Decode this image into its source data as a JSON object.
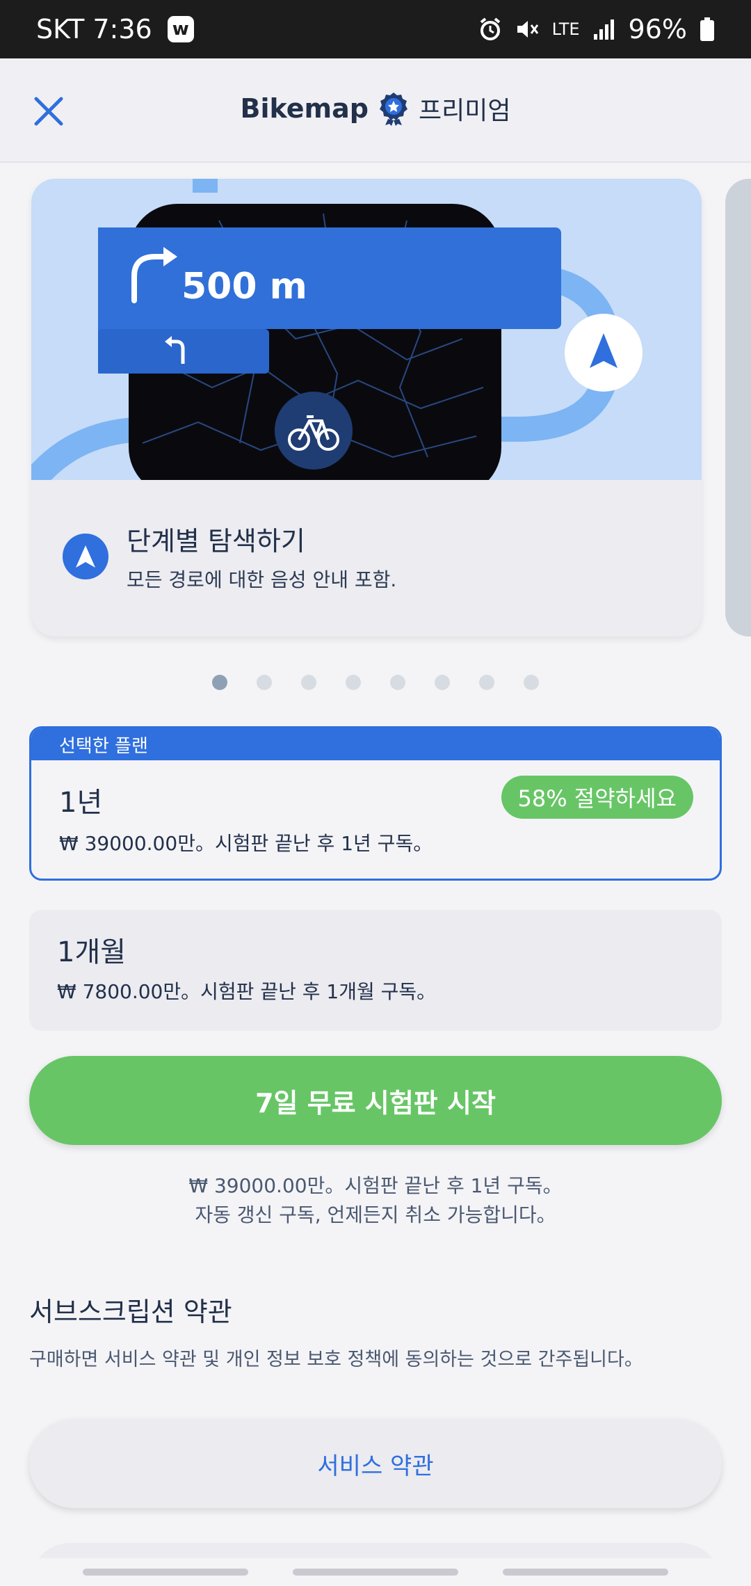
{
  "status_bar": {
    "carrier_time": "SKT 7:36",
    "badge": "w",
    "network": "LTE",
    "battery": "96%"
  },
  "header": {
    "brand": "Bikemap",
    "premium": "프리미엄"
  },
  "carousel": {
    "distance": "500 m",
    "feature_title": "단계별 탐색하기",
    "feature_desc": "모든 경로에 대한 음성 안내 포함.",
    "dot_count": 8,
    "active_dot": 0
  },
  "plans": {
    "selected_banner": "선택한 플랜",
    "yearly": {
      "name": "1년",
      "price": "₩ 39000.00만。시험판 끝난 후 1년 구독。",
      "badge": "58% 절약하세요"
    },
    "monthly": {
      "name": "1개월",
      "price": "₩ 7800.00만。시험판 끝난 후 1개월 구독。"
    }
  },
  "cta": {
    "label": "7일 무료 시험판 시작",
    "note_line1": "₩ 39000.00만。시험판 끝난 후 1년 구독。",
    "note_line2": "자동 갱신 구독, 언제든지 취소 가능합니다。"
  },
  "terms": {
    "title": "서브스크립션 약관",
    "desc": "구매하면 서비스 약관 및 개인 정보 보호 정책에 동의하는 것으로 간주됩니다。",
    "service_terms_label": "서비스 약관"
  },
  "colors": {
    "accent_blue": "#2f6fde",
    "accent_green": "#67c565",
    "text_dark": "#22304a"
  },
  "icons": [
    "close-icon",
    "premium-badge-icon",
    "turn-right-arrow-icon",
    "turn-left-arrow-icon",
    "bicycle-icon",
    "navigation-arrow-icon"
  ]
}
